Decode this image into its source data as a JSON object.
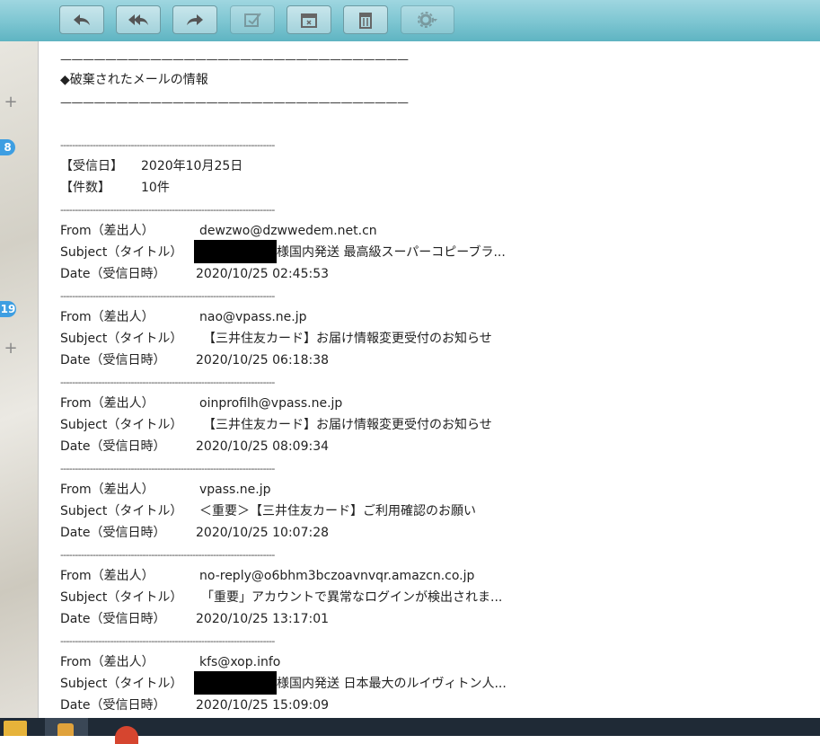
{
  "toolbar": {
    "buttons": [
      {
        "icon": "reply-icon",
        "enabled": true
      },
      {
        "icon": "reply-all-icon",
        "enabled": true
      },
      {
        "icon": "forward-icon",
        "enabled": true
      },
      {
        "icon": "edit-icon",
        "enabled": false
      },
      {
        "icon": "archive-icon",
        "enabled": true
      },
      {
        "icon": "trash-icon",
        "enabled": true
      },
      {
        "icon": "gear-icon",
        "enabled": false
      }
    ]
  },
  "sidebar": {
    "badges": [
      "8",
      "19"
    ]
  },
  "content": {
    "rule_long": "———————————————————————————————",
    "heading": "◆破棄されたメールの情報",
    "rule_short": "-------------------------------------------------------------------------",
    "received_label": "【受信日】",
    "received_value": "2020年10月25日",
    "count_label": "【件数】",
    "count_value": "10件",
    "from_label": "From（差出人）",
    "subject_label": "Subject（タイトル）",
    "date_label": "Date（受信日時）",
    "emails": [
      {
        "from": "dewzwo@dzwwedem.net.cn",
        "subject": "様国内発送 最高級スーパーコピーブラ...",
        "date": "2020/10/25 02:45:53",
        "redacted": true
      },
      {
        "from": "nao@vpass.ne.jp",
        "subject": "【三井住友カード】お届け情報変更受付のお知らせ",
        "date": "2020/10/25 06:18:38",
        "redacted": false
      },
      {
        "from": "oinprofilh@vpass.ne.jp",
        "subject": "【三井住友カード】お届け情報変更受付のお知らせ",
        "date": "2020/10/25 08:09:34",
        "redacted": false
      },
      {
        "from": "vpass.ne.jp",
        "subject": "＜重要＞【三井住友カード】ご利用確認のお願い",
        "date": "2020/10/25 10:07:28",
        "redacted": false
      },
      {
        "from": "no-reply@o6bhm3bczoavnvqr.amazcn.co.jp",
        "subject": "「重要」アカウントで異常なログインが検出されま...",
        "date": "2020/10/25 13:17:01",
        "redacted": false
      },
      {
        "from": "kfs@xop.info",
        "subject": "様国内発送 日本最大のルイヴィトン人...",
        "date": "2020/10/25 15:09:09",
        "redacted": true
      }
    ]
  }
}
